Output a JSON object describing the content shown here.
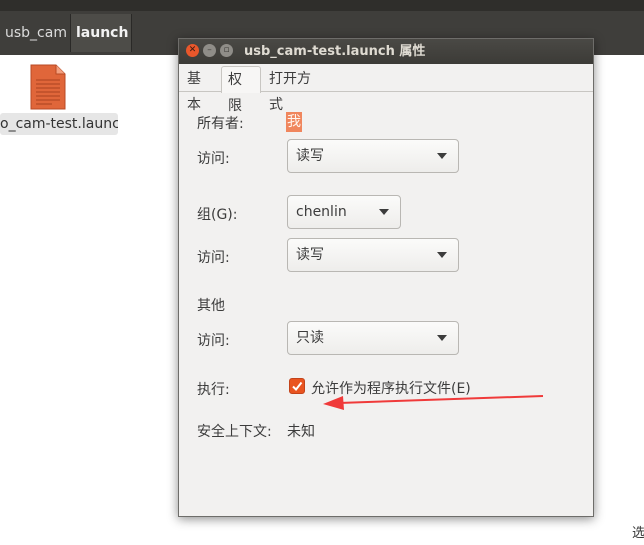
{
  "file_manager": {
    "breadcrumbs": [
      "usb_cam",
      "launch"
    ],
    "file_name": "usb_cam-test.launch",
    "file_label_visible": "o_cam-test.launch",
    "status_text": "选"
  },
  "dialog": {
    "title": "usb_cam-test.launch 属性",
    "tabs": [
      "基本",
      "权限",
      "打开方式"
    ],
    "active_tab": "权限",
    "owner": {
      "label": "所有者:",
      "value": "我"
    },
    "owner_access": {
      "label": "访问:",
      "value": "读写"
    },
    "group": {
      "label": "组(G):",
      "value": "chenlin"
    },
    "group_access": {
      "label": "访问:",
      "value": "读写"
    },
    "others": {
      "label": "其他"
    },
    "others_access": {
      "label": "访问:",
      "value": "只读"
    },
    "execute": {
      "label": "执行:",
      "checkbox_label": "允许作为程序执行文件(E)",
      "checked": true
    },
    "security_context": {
      "label": "安全上下文:",
      "value": "未知"
    }
  },
  "colors": {
    "accent": "#e95420",
    "annotation_arrow": "#f03a3a"
  }
}
